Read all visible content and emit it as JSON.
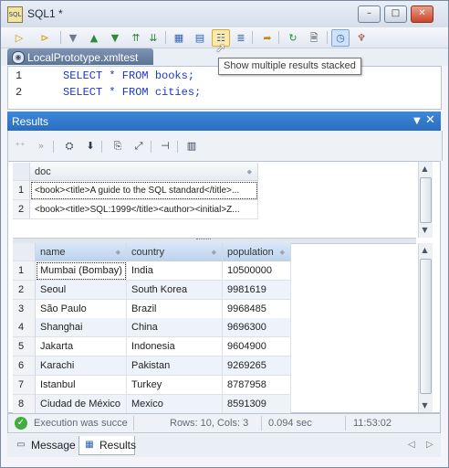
{
  "window": {
    "title": "SQL1 *",
    "app_icon_text": "SQL",
    "minimize": "–",
    "maximize": "□",
    "close": "✕"
  },
  "toolbar": {
    "buttons": [
      {
        "name": "execute-icon",
        "glyph": "▷",
        "color": "#d39a00"
      },
      {
        "name": "execute-step-icon",
        "glyph": "⊳",
        "color": "#d39a00"
      },
      {
        "name": "stop-icon",
        "glyph": "▼",
        "color": "#6d7b8e"
      },
      {
        "name": "move-up-icon",
        "glyph": "▲",
        "color": "#2e8b3a"
      },
      {
        "name": "move-down-icon",
        "glyph": "▼",
        "color": "#2e8b3a"
      },
      {
        "name": "move-top-icon",
        "glyph": "⇈",
        "color": "#2e8b3a"
      },
      {
        "name": "move-bottom-icon",
        "glyph": "⇊",
        "color": "#2e8b3a"
      },
      {
        "name": "grid-view-icon",
        "glyph": "▦",
        "color": "#2a5fb0"
      },
      {
        "name": "tabbed-results-icon",
        "glyph": "▤",
        "color": "#2a5fb0"
      },
      {
        "name": "stacked-results-icon",
        "glyph": "☷",
        "color": "#2a5fb0"
      },
      {
        "name": "text-view-icon",
        "glyph": "≣",
        "color": "#2a5fb0"
      },
      {
        "name": "open-file-icon",
        "glyph": "➦",
        "color": "#c98a1a"
      },
      {
        "name": "refresh-icon",
        "glyph": "↻",
        "color": "#2e8b3a"
      },
      {
        "name": "script-icon",
        "glyph": "🗎",
        "color": "#444444"
      },
      {
        "name": "autocommit-icon",
        "glyph": "◷",
        "color": "#2a5fb0"
      },
      {
        "name": "tree-icon",
        "glyph": "♆",
        "color": "#9a4a2a"
      }
    ],
    "tooltip": "Show multiple results stacked"
  },
  "document": {
    "tab_label": "LocalPrototype.xmltest",
    "lines": [
      {
        "num": "1",
        "text": "SELECT * FROM books;"
      },
      {
        "num": "2",
        "text": "SELECT * FROM cities;"
      }
    ]
  },
  "results": {
    "title": "Results",
    "drop_glyph": "▼",
    "close_glyph": "✕",
    "toolbar": [
      {
        "name": "previous-result-icon",
        "glyph": "⁺⁺",
        "dim": true
      },
      {
        "name": "next-result-icon",
        "glyph": "»",
        "dim": true
      },
      {
        "name": "find-in-results-icon",
        "glyph": "⛭",
        "dim": false
      },
      {
        "name": "export-icon",
        "glyph": "⬇",
        "dim": false
      },
      {
        "name": "copy-cell-icon",
        "glyph": "⎘",
        "dim": false
      },
      {
        "name": "maximize-results-icon",
        "glyph": "⤢",
        "dim": false
      },
      {
        "name": "pin-icon",
        "glyph": "⊣",
        "dim": false
      },
      {
        "name": "chart-icon",
        "glyph": "▥",
        "dim": false
      }
    ],
    "grid1": {
      "columns": [
        "doc"
      ],
      "rows": [
        {
          "num": "1",
          "doc": "<book><title>A guide to the SQL standard</title>..."
        },
        {
          "num": "2",
          "doc": "<book><title>SQL:1999</title><author><initial>Z..."
        }
      ]
    },
    "grid2": {
      "columns": [
        "name",
        "country",
        "population"
      ],
      "rows": [
        {
          "num": "1",
          "name": "Mumbai (Bombay)",
          "country": "India",
          "population": "10500000"
        },
        {
          "num": "2",
          "name": "Seoul",
          "country": "South Korea",
          "population": "9981619"
        },
        {
          "num": "3",
          "name": "São Paulo",
          "country": "Brazil",
          "population": "9968485"
        },
        {
          "num": "4",
          "name": "Shanghai",
          "country": "China",
          "population": "9696300"
        },
        {
          "num": "5",
          "name": "Jakarta",
          "country": "Indonesia",
          "population": "9604900"
        },
        {
          "num": "6",
          "name": "Karachi",
          "country": "Pakistan",
          "population": "9269265"
        },
        {
          "num": "7",
          "name": "Istanbul",
          "country": "Turkey",
          "population": "8787958"
        },
        {
          "num": "8",
          "name": "Ciudad de México",
          "country": "Mexico",
          "population": "8591309"
        }
      ]
    },
    "status": {
      "icon": "✓",
      "message": "Execution was succe",
      "rows_cols": "Rows: 10, Cols: 3",
      "time": "0.094 sec",
      "clock": "11:53:02"
    }
  },
  "bottom_tabs": {
    "message": "Message",
    "results": "Results",
    "prev": "◁",
    "next": "▷"
  }
}
